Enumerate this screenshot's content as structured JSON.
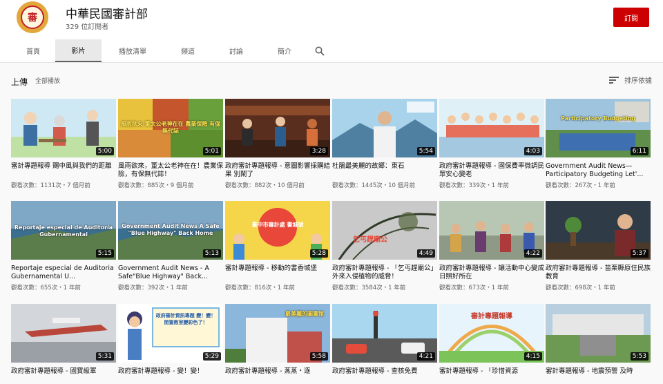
{
  "channel": {
    "name": "中華民國審計部",
    "subscribers": "329 位訂閱者",
    "subscribe_label": "訂閱",
    "logo_text": "審"
  },
  "tabs": [
    "首頁",
    "影片",
    "播放清單",
    "頻道",
    "討論",
    "簡介"
  ],
  "search_icon": "search-icon",
  "section": {
    "title": "上傳",
    "play_all": "全部播放",
    "sort_label": "排序依據"
  },
  "videos": [
    {
      "title": "審計專題報導 賜中風與我們的距離",
      "meta": "觀看次數：1131次・7 個月前",
      "duration": "5:00",
      "thumb_text": ""
    },
    {
      "title": "風雨欲來，董太公老神在在！農業保險，有保無代誌！",
      "meta": "觀看次數：885次・9 個月前",
      "duration": "5:01",
      "thumb_text": "風雨欲來 董太公老神在在 農業保險 有保無代誌"
    },
    {
      "title": "政府審計專題報導 - 意圖影響採購結果 別鬧了",
      "meta": "觀看次數：882次・10 個月前",
      "duration": "3:28",
      "thumb_text": ""
    },
    {
      "title": "杜鵑最美麗的故鄉：東石",
      "meta": "觀看次數：1445次・10 個月前",
      "duration": "5:54",
      "thumb_text": ""
    },
    {
      "title": "政府審計專題報導 - 國保費率微調民眾安心變老",
      "meta": "觀看次數：339次・1 年前",
      "duration": "4:03",
      "thumb_text": ""
    },
    {
      "title": "Government Audit News— Participatory Budgeting Let'...",
      "meta": "觀看次數：267次・1 年前",
      "duration": "6:11",
      "thumb_text": "Participatory Budgeting"
    },
    {
      "title": "Reportaje especial de Auditoria Gubernamental U...",
      "meta": "觀看次數：655次・1 年前",
      "duration": "5:15",
      "thumb_text": "Reportaje especial de Auditoría Gubernamental"
    },
    {
      "title": "Government Audit News - A Safe\"Blue Highway\" Back...",
      "meta": "觀看次數：392次・1 年前",
      "duration": "5:13",
      "thumb_text": "Government Audit News A Safe \"Blue Highway\" Back Home"
    },
    {
      "title": "審計專題報導 - 移動的書香城堡",
      "meta": "觀看次數：816次・1 年前",
      "duration": "5:28",
      "thumb_text": "臺中市審計處 書城號"
    },
    {
      "title": "政府審計專題報導 - 「乞丐趕廟公」外來入侵植物的威脅！",
      "meta": "觀看次數：3584次・1 年前",
      "duration": "4:49",
      "thumb_text": "乞丐趕廟公"
    },
    {
      "title": "政府審計專題報導 - 讓活動中心變成日照好所在",
      "meta": "觀看次數：673次・1 年前",
      "duration": "4:22",
      "thumb_text": ""
    },
    {
      "title": "政府審計專題報導 - 苗栗縣原住民族教育",
      "meta": "觀看次數：698次・1 年前",
      "duration": "5:37",
      "thumb_text": ""
    },
    {
      "title": "政府審計專題報導 - 國寶級軍",
      "meta": "",
      "duration": "5:31",
      "thumb_text": ""
    },
    {
      "title": "政府審計專題報導 - 變！變！",
      "meta": "",
      "duration": "5:29",
      "thumb_text": "政府審計資訊專題 變！變！ 閒置教室變彩色了！"
    },
    {
      "title": "政府審計專題報導 - 蒸蒸・逐",
      "meta": "",
      "duration": "5:58",
      "thumb_text": "最美麗的圖書館"
    },
    {
      "title": "政府審計專題報導 - 查核免費",
      "meta": "",
      "duration": "4:21",
      "thumb_text": ""
    },
    {
      "title": "審計專題報導 - 「珍惜資源",
      "meta": "",
      "duration": "4:15",
      "thumb_text": "審計專題報導"
    },
    {
      "title": "審計專題報導 - 地震預警 及時",
      "meta": "",
      "duration": "5:53",
      "thumb_text": ""
    }
  ]
}
